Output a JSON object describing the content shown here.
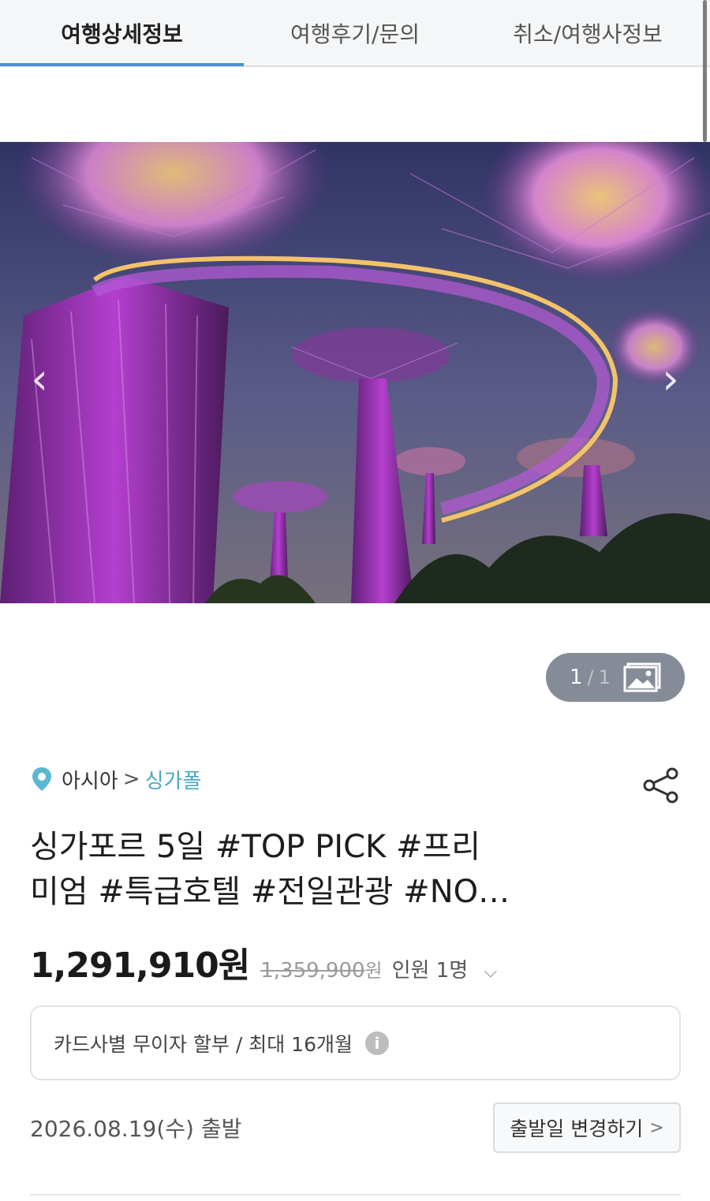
{
  "tabs": [
    {
      "label": "여행상세정보",
      "active": true
    },
    {
      "label": "여행후기/문의",
      "active": false
    },
    {
      "label": "취소/여행사정보",
      "active": false
    }
  ],
  "hero": {
    "icons": {
      "prev": "chevron-left-icon",
      "next": "chevron-right-icon"
    },
    "counter": {
      "current": "1",
      "separator": "/",
      "total": "1",
      "icon": "gallery-icon"
    }
  },
  "breadcrumb": {
    "region": "아시아",
    "separator": ">",
    "country": "싱가폴",
    "icon": "location-pin-icon",
    "accent": "#4aa6c3"
  },
  "share_icon": "share-icon",
  "product": {
    "title_line1": "싱가포르 5일 #TOP PICK #프리",
    "title_line2": "미엄 #특급호텔 #전일관광 #NO…"
  },
  "price": {
    "current": "1,291,910원",
    "original": "1,359,900",
    "original_unit": "원",
    "people": "인원 1명",
    "dropdown_icon": "chevron-down-icon"
  },
  "installment": {
    "text": "카드사별 무이자 할부 / 최대 16개월",
    "info_icon": "info-icon",
    "info_glyph": "i"
  },
  "departure": {
    "date": "2026.08.19(수) 출발",
    "change_label": "출발일 변경하기",
    "change_arrow": ">"
  }
}
